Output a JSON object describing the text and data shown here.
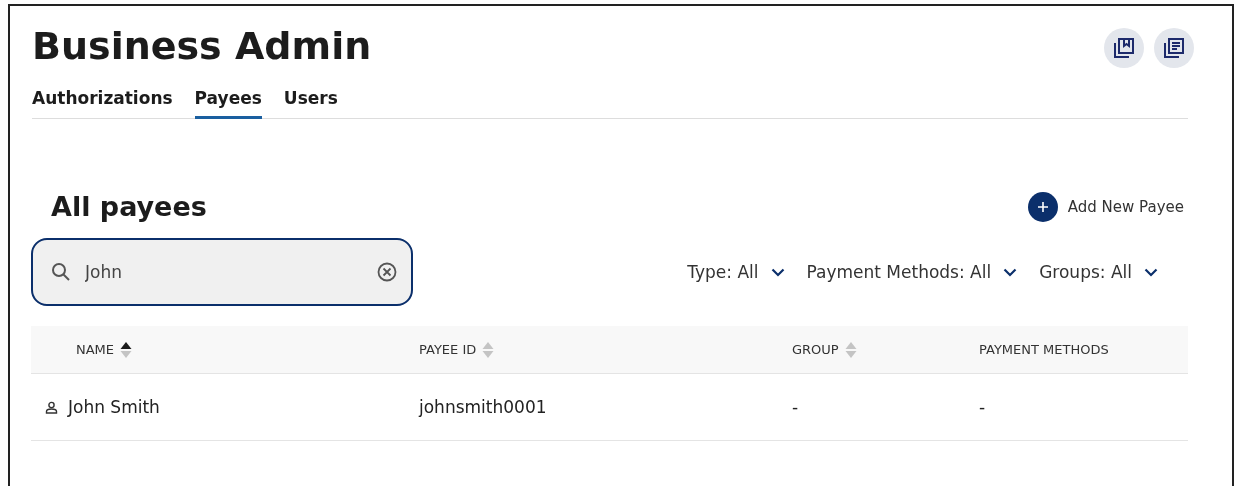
{
  "title": "Business Admin",
  "tabs": [
    {
      "label": "Authorizations",
      "selected": false
    },
    {
      "label": "Payees",
      "selected": true
    },
    {
      "label": "Users",
      "selected": false
    }
  ],
  "section": {
    "title": "All payees",
    "add_button": "Add New Payee"
  },
  "search": {
    "value": "John",
    "focused": true
  },
  "filters": [
    {
      "label": "Type: All"
    },
    {
      "label": "Payment Methods: All"
    },
    {
      "label": "Groups: All"
    }
  ],
  "table": {
    "columns": [
      {
        "label": "NAME",
        "sortable": true,
        "sorted": true
      },
      {
        "label": "PAYEE ID",
        "sortable": true,
        "sorted": false
      },
      {
        "label": "GROUP",
        "sortable": true,
        "sorted": false
      },
      {
        "label": "PAYMENT METHODS",
        "sortable": false
      }
    ],
    "rows": [
      {
        "cells": [
          "John Smith",
          "johnsmith0001",
          "-",
          "-"
        ]
      }
    ]
  }
}
